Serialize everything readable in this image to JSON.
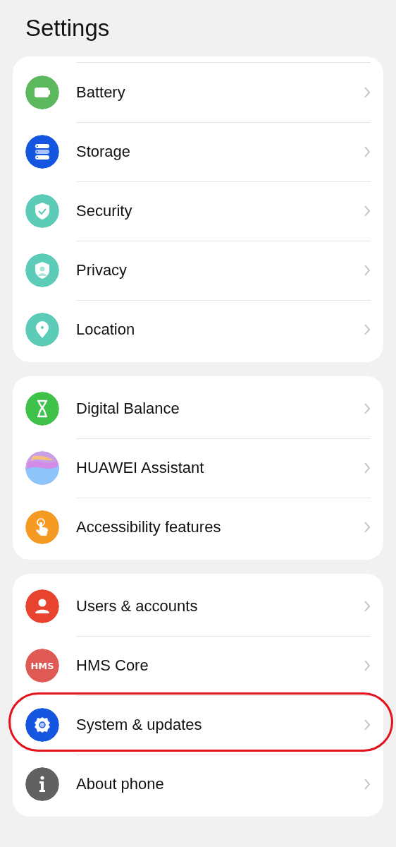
{
  "title": "Settings",
  "groups": [
    {
      "items": [
        {
          "label": "Battery",
          "kind": "battery",
          "highlighted": false
        },
        {
          "label": "Storage",
          "kind": "storage",
          "highlighted": false
        },
        {
          "label": "Security",
          "kind": "security",
          "highlighted": false
        },
        {
          "label": "Privacy",
          "kind": "privacy",
          "highlighted": false
        },
        {
          "label": "Location",
          "kind": "location",
          "highlighted": false
        }
      ]
    },
    {
      "items": [
        {
          "label": "Digital Balance",
          "kind": "balance",
          "highlighted": false
        },
        {
          "label": "HUAWEI Assistant",
          "kind": "assistant",
          "highlighted": false
        },
        {
          "label": "Accessibility features",
          "kind": "accessibility",
          "highlighted": false
        }
      ]
    },
    {
      "items": [
        {
          "label": "Users & accounts",
          "kind": "users",
          "highlighted": false
        },
        {
          "label": "HMS Core",
          "kind": "hms",
          "icon_text": "HMS",
          "highlighted": false
        },
        {
          "label": "System & updates",
          "kind": "system",
          "highlighted": true
        },
        {
          "label": "About phone",
          "kind": "about",
          "highlighted": false
        }
      ]
    }
  ]
}
